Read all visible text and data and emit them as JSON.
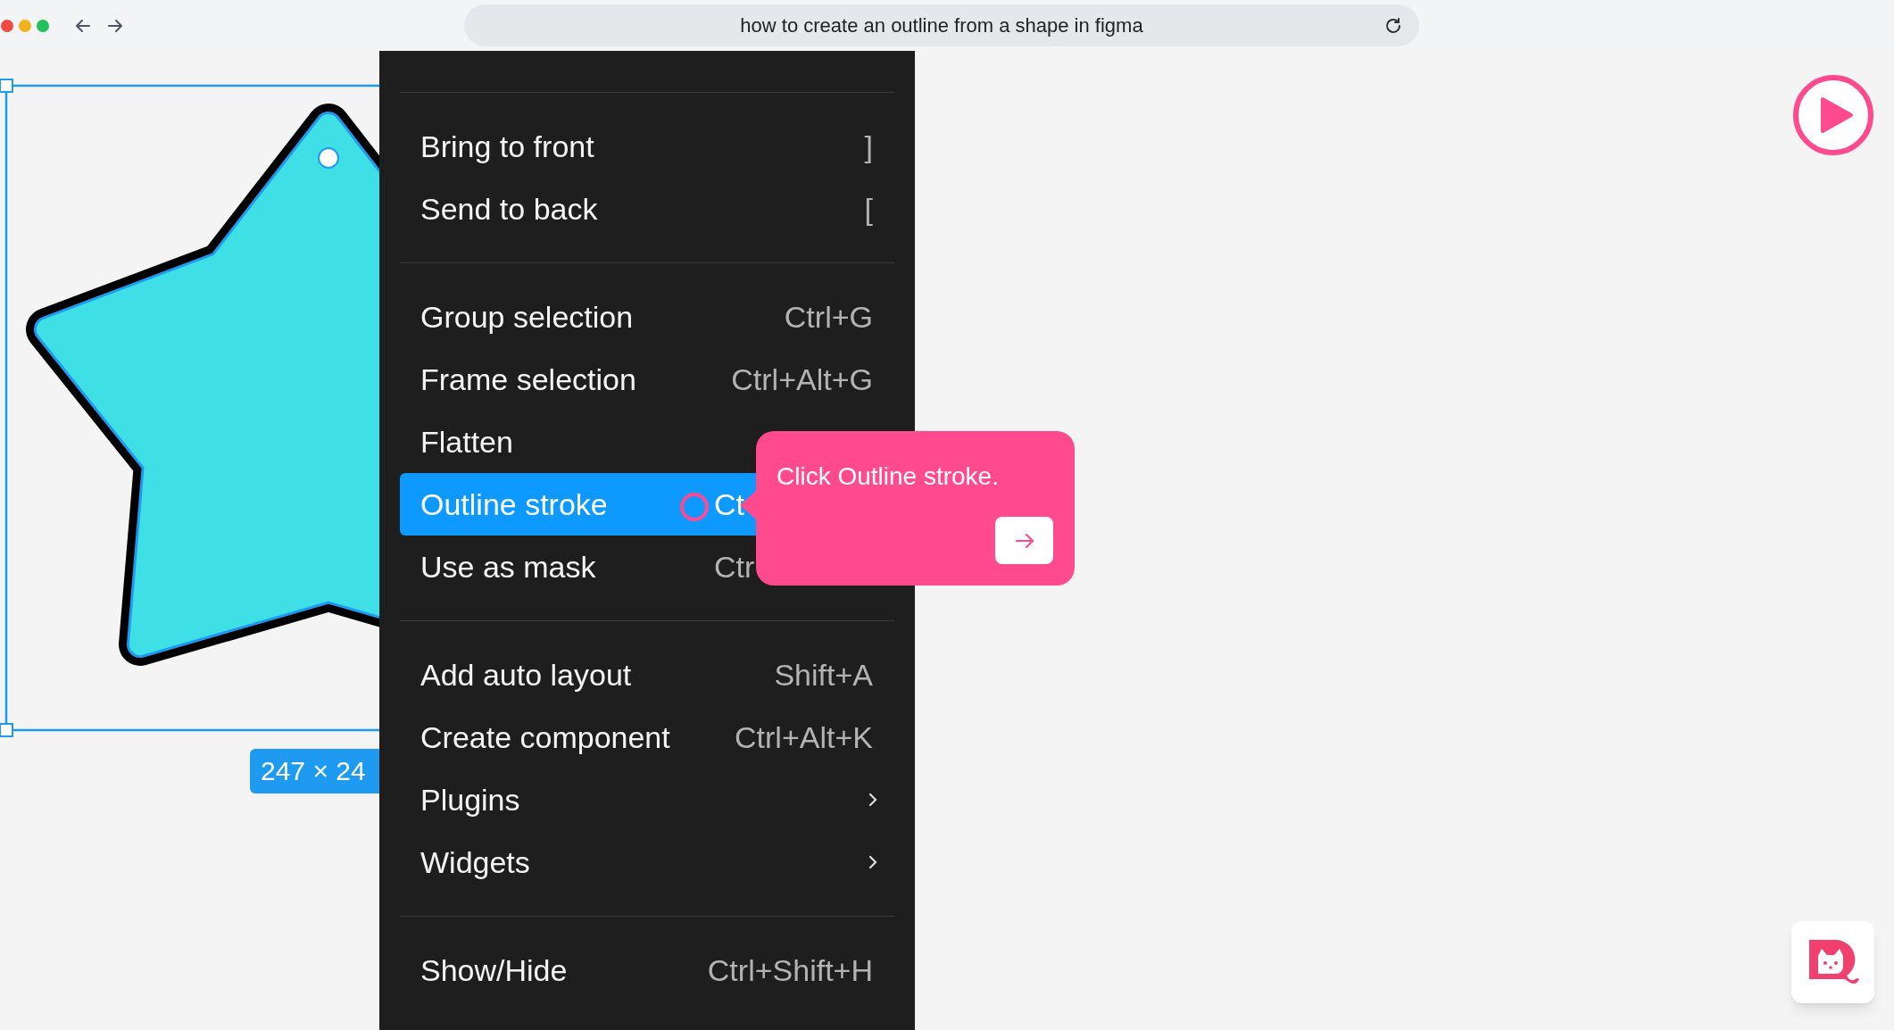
{
  "browser": {
    "address": "how to create an outline from a shape in figma"
  },
  "canvas": {
    "size_label": "247 × 24"
  },
  "context_menu": {
    "sections": [
      {
        "items": [
          {
            "label": "Bring to front",
            "shortcut": "]",
            "kind": "item",
            "selected": false
          },
          {
            "label": "Send to back",
            "shortcut": "[",
            "kind": "item",
            "selected": false
          }
        ]
      },
      {
        "items": [
          {
            "label": "Group selection",
            "shortcut": "Ctrl+G",
            "kind": "item",
            "selected": false
          },
          {
            "label": "Frame selection",
            "shortcut": "Ctrl+Alt+G",
            "kind": "item",
            "selected": false
          },
          {
            "label": "Flatten",
            "kind": "item",
            "selected": false
          },
          {
            "label": "Outline stroke",
            "shortcut": "Ct",
            "shortcut_cut": true,
            "kind": "item",
            "selected": true
          },
          {
            "label": "Use as mask",
            "shortcut": "Ctr",
            "shortcut_cut": true,
            "kind": "item",
            "selected": false
          }
        ]
      },
      {
        "items": [
          {
            "label": "Add auto layout",
            "shortcut": "Shift+A",
            "kind": "item",
            "selected": false
          },
          {
            "label": "Create component",
            "shortcut": "Ctrl+Alt+K",
            "kind": "item",
            "selected": false
          },
          {
            "label": "Plugins",
            "kind": "submenu",
            "selected": false
          },
          {
            "label": "Widgets",
            "kind": "submenu",
            "selected": false
          }
        ]
      },
      {
        "items": [
          {
            "label": "Show/Hide",
            "shortcut": "Ctrl+Shift+H",
            "kind": "item",
            "selected": false
          }
        ]
      }
    ]
  },
  "tooltip": {
    "text": "Click Outline stroke."
  }
}
